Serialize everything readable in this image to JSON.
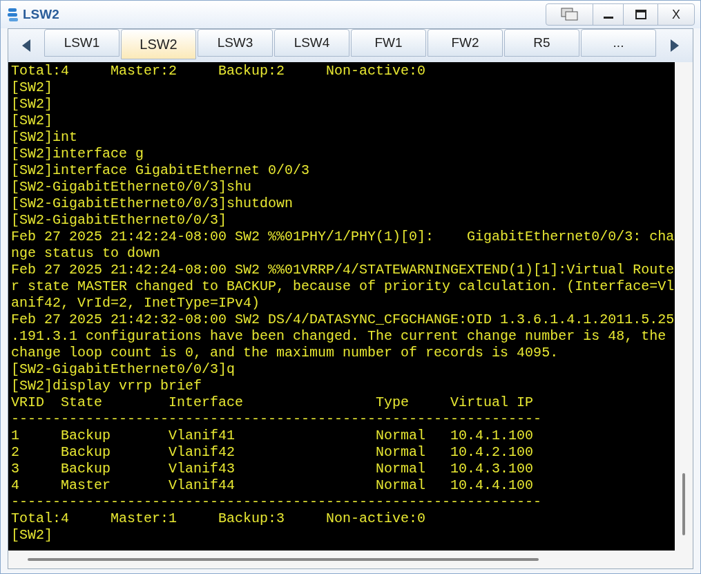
{
  "window": {
    "title": "LSW2",
    "close_label": "X"
  },
  "tabs": [
    {
      "label": "LSW1",
      "selected": false
    },
    {
      "label": "LSW2",
      "selected": true
    },
    {
      "label": "LSW3",
      "selected": false
    },
    {
      "label": "LSW4",
      "selected": false
    },
    {
      "label": "FW1",
      "selected": false
    },
    {
      "label": "FW2",
      "selected": false
    },
    {
      "label": "R5",
      "selected": false
    },
    {
      "label": "...",
      "selected": false
    }
  ],
  "terminal": {
    "lines": [
      "Total:4     Master:2     Backup:2     Non-active:0",
      "[SW2]",
      "[SW2]",
      "[SW2]",
      "[SW2]int",
      "[SW2]interface g",
      "[SW2]interface GigabitEthernet 0/0/3",
      "[SW2-GigabitEthernet0/0/3]shu",
      "[SW2-GigabitEthernet0/0/3]shutdown",
      "[SW2-GigabitEthernet0/0/3]",
      "Feb 27 2025 21:42:24-08:00 SW2 %%01PHY/1/PHY(1)[0]:    GigabitEthernet0/0/3: cha",
      "nge status to down",
      "Feb 27 2025 21:42:24-08:00 SW2 %%01VRRP/4/STATEWARNINGEXTEND(1)[1]:Virtual Route",
      "r state MASTER changed to BACKUP, because of priority calculation. (Interface=Vl",
      "anif42, VrId=2, InetType=IPv4)",
      "Feb 27 2025 21:42:32-08:00 SW2 DS/4/DATASYNC_CFGCHANGE:OID 1.3.6.1.4.1.2011.5.25",
      ".191.3.1 configurations have been changed. The current change number is 48, the",
      "change loop count is 0, and the maximum number of records is 4095.",
      "[SW2-GigabitEthernet0/0/3]q",
      "[SW2]display vrrp brief",
      "VRID  State        Interface                Type     Virtual IP",
      "----------------------------------------------------------------",
      "1     Backup       Vlanif41                 Normal   10.4.1.100",
      "2     Backup       Vlanif42                 Normal   10.4.2.100",
      "3     Backup       Vlanif43                 Normal   10.4.3.100",
      "4     Master       Vlanif44                 Normal   10.4.4.100",
      "----------------------------------------------------------------",
      "Total:4     Master:1     Backup:3     Non-active:0",
      "[SW2]"
    ]
  }
}
